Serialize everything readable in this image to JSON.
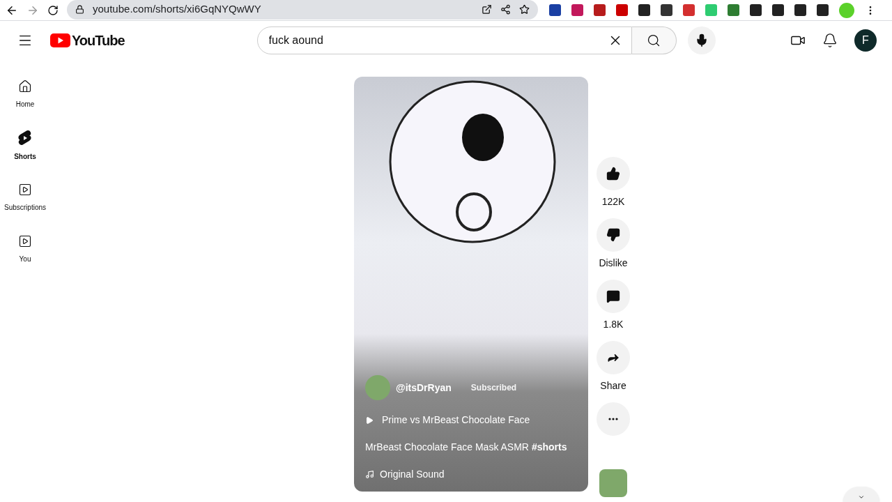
{
  "browser": {
    "url": "youtube.com/shorts/xi6GqNYQwWY"
  },
  "header": {
    "logo": "YouTube",
    "search": {
      "value": "fuck aound"
    },
    "avatar_letter": "F"
  },
  "sidebar": {
    "items": [
      {
        "label": "Home",
        "kind": "home",
        "selected": false
      },
      {
        "label": "Shorts",
        "kind": "shorts",
        "selected": true
      },
      {
        "label": "Subscriptions",
        "kind": "subscriptions",
        "selected": false
      },
      {
        "label": "You",
        "kind": "you",
        "selected": false
      }
    ]
  },
  "short": {
    "channel": "@itsDrRyan",
    "subscribe": "Subscribed",
    "subscribed": true,
    "playlist": "Prime vs MrBeast Chocolate Face",
    "title": "MrBeast Chocolate Face Mask ASMR **#shorts**",
    "sound": "Original Sound"
  },
  "actions": [
    {
      "kind": "like",
      "label": "122K"
    },
    {
      "kind": "dislike",
      "label": "Dislike"
    },
    {
      "kind": "comments",
      "label": "1.8K"
    },
    {
      "kind": "share",
      "label": "Share"
    },
    {
      "kind": "more"
    },
    {
      "kind": "sound-avatar"
    }
  ]
}
